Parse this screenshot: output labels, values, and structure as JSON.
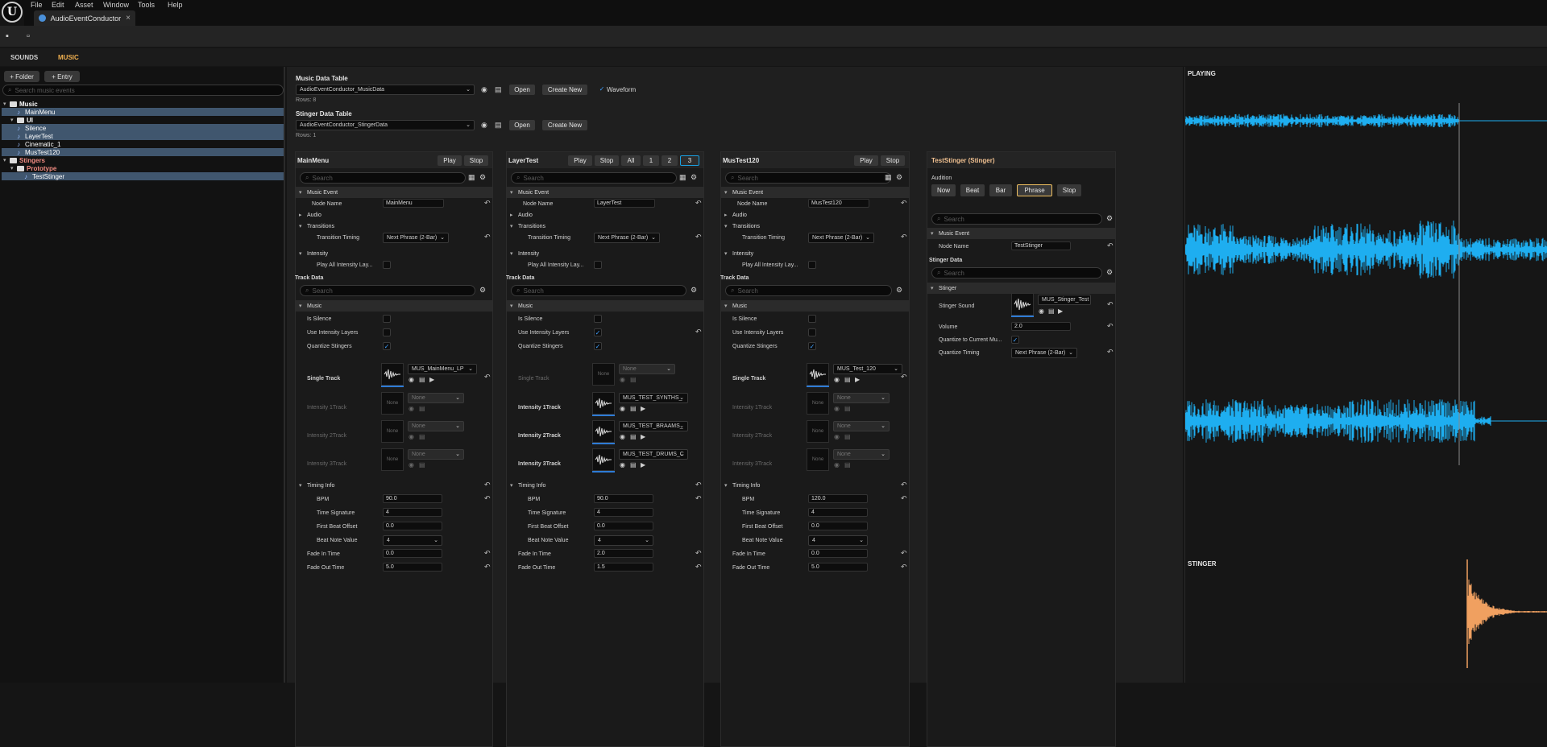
{
  "menu": [
    "File",
    "Edit",
    "Asset",
    "Window",
    "Tools",
    "Help"
  ],
  "logo": "U",
  "doc_tab": {
    "title": "AudioEventConductor",
    "close": "×"
  },
  "modes": {
    "sounds": "SOUNDS",
    "music": "MUSIC"
  },
  "left": {
    "folder_btn": "+ Folder",
    "entry_btn": "+ Entry",
    "search_placeholder": "Search music events",
    "tree": [
      {
        "label": "Music",
        "kind": "folder",
        "color": "#ffffff",
        "depth": 0
      },
      {
        "label": "MainMenu",
        "kind": "item",
        "color": "#ffffff",
        "depth": 1,
        "selected": true
      },
      {
        "label": "UI",
        "kind": "folder",
        "color": "#ffffff",
        "depth": 1
      },
      {
        "label": "Silence",
        "kind": "item",
        "color": "#ffffff",
        "depth": 1,
        "selected": true
      },
      {
        "label": "LayerTest",
        "kind": "item",
        "color": "#ffffff",
        "depth": 1,
        "selected": true
      },
      {
        "label": "Cinematic_1",
        "kind": "item",
        "color": "#ffffff",
        "depth": 1
      },
      {
        "label": "MusTest120",
        "kind": "item",
        "color": "#ffffff",
        "depth": 1,
        "selected": true
      },
      {
        "label": "Stingers",
        "kind": "folder",
        "color": "#f08a80",
        "depth": 0
      },
      {
        "label": "Prototype",
        "kind": "folder",
        "color": "#f08a80",
        "depth": 1
      },
      {
        "label": "TestStinger",
        "kind": "item",
        "color": "#ffffff",
        "depth": 2,
        "selected": true
      }
    ]
  },
  "tables": {
    "music_title": "Music Data Table",
    "music_asset": "AudioEventConductor_MusicData",
    "music_rows": "Rows: 8",
    "stinger_title": "Stinger Data Table",
    "stinger_asset": "AudioEventConductor_StingerData",
    "stinger_rows": "Rows: 1",
    "open": "Open",
    "create_new": "Create New",
    "waveform": "Waveform"
  },
  "columns": [
    {
      "title": "MainMenu",
      "buttons": [
        "Play",
        "Stop"
      ],
      "node_name": "MainMenu",
      "transition_timing": "Next Phrase (2-Bar)",
      "is_silence": false,
      "use_intensity": false,
      "quantize": true,
      "single_track": "MUS_MainMenu_LP",
      "single_dim": false,
      "t1": "None",
      "t2": "None",
      "t3": "None",
      "tracks_dim": true,
      "bpm": "90.0",
      "time_sig": "4",
      "first_beat": "0.0",
      "beat_note": "4",
      "fade_in": "0.0",
      "fade_out": "5.0"
    },
    {
      "title": "LayerTest",
      "buttons": [
        "Play",
        "Stop",
        "All",
        "1",
        "2",
        "3"
      ],
      "node_name": "LayerTest",
      "transition_timing": "Next Phrase (2-Bar)",
      "is_silence": false,
      "use_intensity": true,
      "quantize": true,
      "single_track": "None",
      "single_dim": true,
      "t1": "MUS_TEST_SYNTHS_",
      "t2": "MUS_TEST_BRAAMS_",
      "t3": "MUS_TEST_DRUMS_C",
      "tracks_dim": false,
      "bpm": "90.0",
      "time_sig": "4",
      "first_beat": "0.0",
      "beat_note": "4",
      "fade_in": "2.0",
      "fade_out": "1.5"
    },
    {
      "title": "MusTest120",
      "buttons": [
        "Play",
        "Stop"
      ],
      "node_name": "MusTest120",
      "transition_timing": "Next Phrase (2-Bar)",
      "is_silence": false,
      "use_intensity": false,
      "quantize": true,
      "single_track": "MUS_Test_120",
      "single_dim": false,
      "t1": "None",
      "t2": "None",
      "t3": "None",
      "tracks_dim": true,
      "bpm": "120.0",
      "time_sig": "4",
      "first_beat": "0.0",
      "beat_note": "4",
      "fade_in": "0.0",
      "fade_out": "5.0"
    }
  ],
  "labels": {
    "search": "Search",
    "music_event": "Music Event",
    "node_name": "Node Name",
    "audio": "Audio",
    "transitions": "Transitions",
    "transition_timing": "Transition Timing",
    "intensity": "Intensity",
    "play_all": "Play All Intensity Lay...",
    "track_data": "Track Data",
    "music": "Music",
    "is_silence": "Is Silence",
    "use_intensity": "Use Intensity Layers",
    "quantize": "Quantize Stingers",
    "single_track": "Single Track",
    "t1": "Intensity 1Track",
    "t2": "Intensity 2Track",
    "t3": "Intensity 3Track",
    "timing_info": "Timing Info",
    "bpm": "BPM",
    "time_sig": "Time Signature",
    "first_beat": "First Beat Offset",
    "beat_note": "Beat Note Value",
    "fade_in": "Fade In Time",
    "fade_out": "Fade Out Time",
    "none": "None"
  },
  "stinger": {
    "title": "TestStinger (Stinger)",
    "audition": "Audition",
    "audition_buttons": [
      "Now",
      "Beat",
      "Bar",
      "Phrase",
      "Stop"
    ],
    "selected": "Phrase",
    "music_event": "Music Event",
    "node_name_label": "Node Name",
    "node_name": "TestStinger",
    "stinger_data": "Stinger Data",
    "stinger_section": "Stinger",
    "sound_label": "Stinger Sound",
    "sound": "MUS_Stinger_Test",
    "volume_label": "Volume",
    "volume": "2.0",
    "qcm_label": "Quantize to Current Mu...",
    "qt_label": "Quantize Timing",
    "qt": "Next Phrase (2-Bar)"
  },
  "right": {
    "playing": "PLAYING",
    "stinger": "STINGER",
    "wave_color": "#1eaef0",
    "stinger_color": "#f0a060"
  }
}
